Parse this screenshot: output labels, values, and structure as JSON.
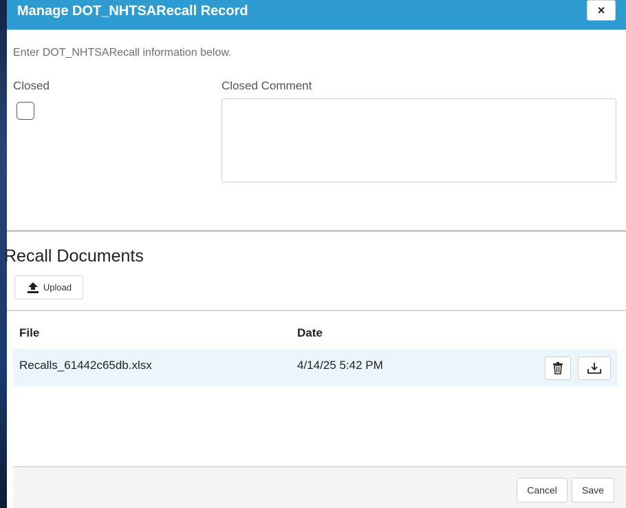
{
  "dialog": {
    "title": "Manage DOT_NHTSARecall Record",
    "close_label": "×",
    "intro": "Enter DOT_NHTSARecall information below."
  },
  "form": {
    "closed_label": "Closed",
    "closed_checked": false,
    "closed_comment_label": "Closed Comment",
    "closed_comment_value": ""
  },
  "documents": {
    "title": "Recall Documents",
    "upload_label": "Upload",
    "upload_icon": "upload-icon",
    "columns": [
      "File",
      "Date"
    ],
    "rows": [
      {
        "file": "Recalls_61442c65db.xlsx",
        "date": "4/14/25 5:42 PM",
        "actions": [
          "trash-icon",
          "download-icon"
        ]
      }
    ]
  },
  "footer": {
    "cancel_label": "Cancel",
    "save_label": "Save"
  },
  "colors": {
    "header": "#2e9bd1",
    "row_highlight": "#eaf5fc"
  }
}
